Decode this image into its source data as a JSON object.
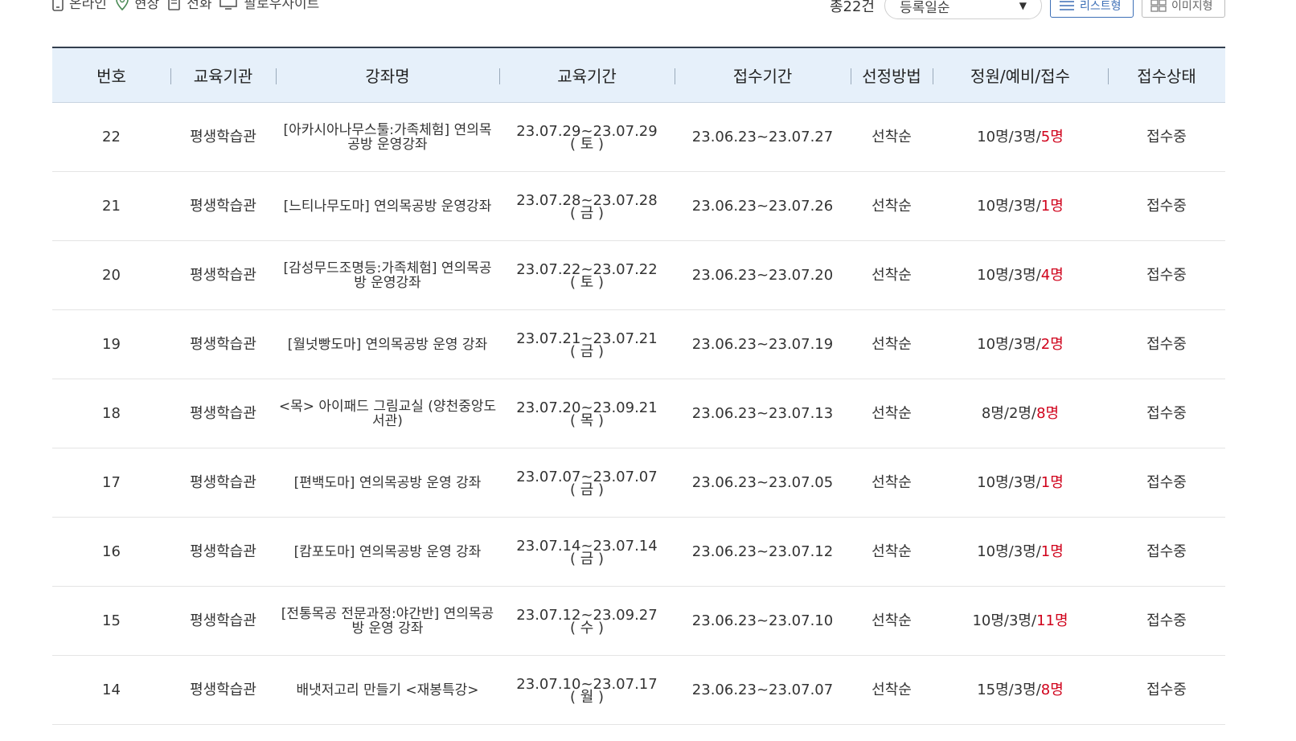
{
  "legend": {
    "items": [
      {
        "label": "온라인",
        "icon": "mobile-icon"
      },
      {
        "label": "현장",
        "icon": "location-pin-icon"
      },
      {
        "label": "전화",
        "icon": "document-phone-icon"
      },
      {
        "label": "팔로우사이트",
        "icon": "monitor-icon"
      }
    ]
  },
  "controls": {
    "total_count": "총22건",
    "sort_selected": "등록일순",
    "view_list_label": "리스트형",
    "view_image_label": "이미지형"
  },
  "table": {
    "headers": [
      "번호",
      "교육기관",
      "강좌명",
      "교육기간",
      "접수기간",
      "선정방법",
      "정원/예비/접수",
      "접수상태"
    ],
    "rows": [
      {
        "no": "22",
        "org": "평생학습관",
        "title": "[아카시아나무스툴:가족체험] 연의목공방 운영강좌",
        "period_main": "23.07.29~23.07.29",
        "period_day": "( 토 )",
        "apply": "23.06.23~23.07.27",
        "method": "선착순",
        "cap": "10명/3명/",
        "applied": "5명",
        "status": "접수중"
      },
      {
        "no": "21",
        "org": "평생학습관",
        "title": "[느티나무도마] 연의목공방 운영강좌",
        "period_main": "23.07.28~23.07.28",
        "period_day": "( 금 )",
        "apply": "23.06.23~23.07.26",
        "method": "선착순",
        "cap": "10명/3명/",
        "applied": "1명",
        "status": "접수중"
      },
      {
        "no": "20",
        "org": "평생학습관",
        "title": "[감성무드조명등:가족체험] 연의목공방 운영강좌",
        "period_main": "23.07.22~23.07.22",
        "period_day": "( 토 )",
        "apply": "23.06.23~23.07.20",
        "method": "선착순",
        "cap": "10명/3명/",
        "applied": "4명",
        "status": "접수중"
      },
      {
        "no": "19",
        "org": "평생학습관",
        "title": "[월넛빵도마] 연의목공방 운영 강좌",
        "period_main": "23.07.21~23.07.21",
        "period_day": "( 금 )",
        "apply": "23.06.23~23.07.19",
        "method": "선착순",
        "cap": "10명/3명/",
        "applied": "2명",
        "status": "접수중"
      },
      {
        "no": "18",
        "org": "평생학습관",
        "title": "<목> 아이패드 그림교실 (양천중앙도서관)",
        "period_main": "23.07.20~23.09.21",
        "period_day": "( 목 )",
        "apply": "23.06.23~23.07.13",
        "method": "선착순",
        "cap": "8명/2명/",
        "applied": "8명",
        "status": "접수중"
      },
      {
        "no": "17",
        "org": "평생학습관",
        "title": "[편백도마] 연의목공방 운영 강좌",
        "period_main": "23.07.07~23.07.07",
        "period_day": "( 금 )",
        "apply": "23.06.23~23.07.05",
        "method": "선착순",
        "cap": "10명/3명/",
        "applied": "1명",
        "status": "접수중"
      },
      {
        "no": "16",
        "org": "평생학습관",
        "title": "[캄포도마] 연의목공방 운영 강좌",
        "period_main": "23.07.14~23.07.14",
        "period_day": "( 금 )",
        "apply": "23.06.23~23.07.12",
        "method": "선착순",
        "cap": "10명/3명/",
        "applied": "1명",
        "status": "접수중"
      },
      {
        "no": "15",
        "org": "평생학습관",
        "title": "[전통목공 전문과정:야간반] 연의목공방 운영 강좌",
        "period_main": "23.07.12~23.09.27",
        "period_day": "( 수 )",
        "apply": "23.06.23~23.07.10",
        "method": "선착순",
        "cap": "10명/3명/",
        "applied": "11명",
        "status": "접수중"
      },
      {
        "no": "14",
        "org": "평생학습관",
        "title": "배냇저고리 만들기 <재봉특강>",
        "period_main": "23.07.10~23.07.17",
        "period_day": "( 월 )",
        "apply": "23.06.23~23.07.07",
        "method": "선착순",
        "cap": "15명/3명/",
        "applied": "8명",
        "status": "접수중"
      }
    ]
  }
}
